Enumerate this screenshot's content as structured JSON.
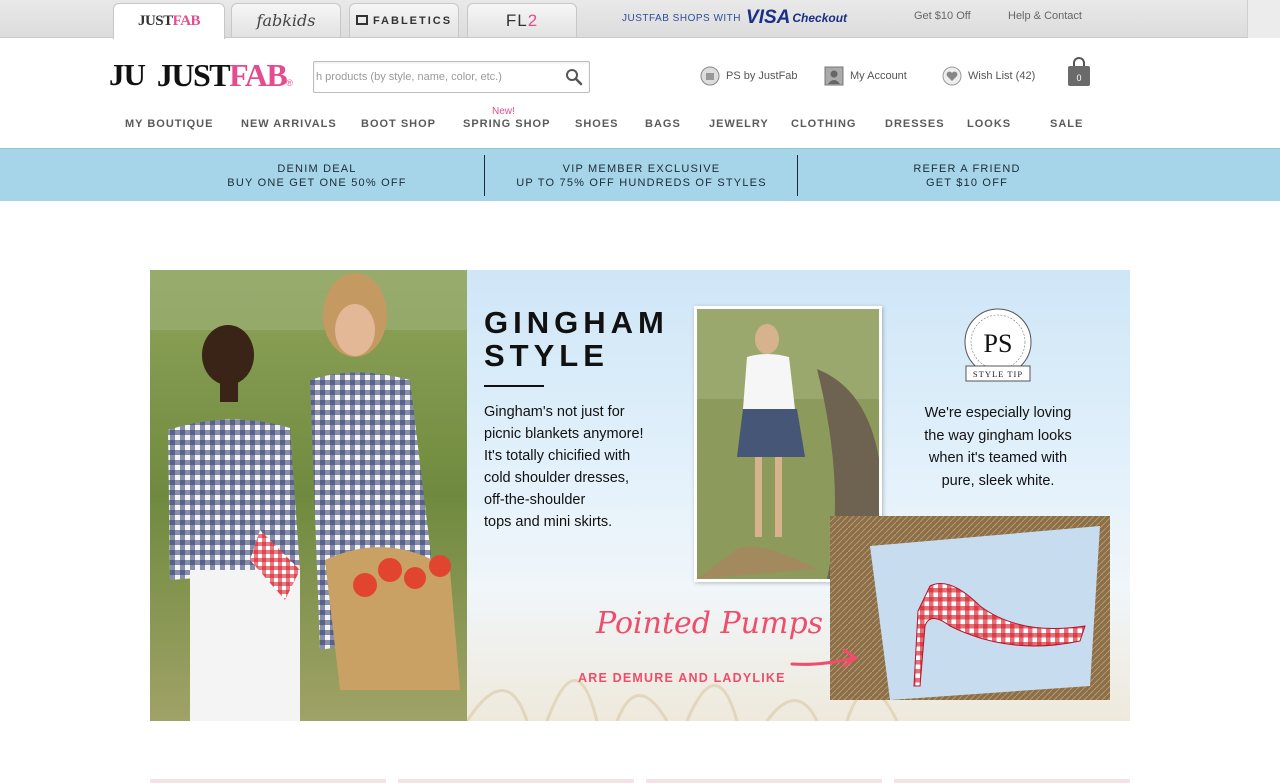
{
  "brand_tabs": [
    {
      "label": "JUST",
      "accent": "FAB"
    },
    {
      "label": "fabkids"
    },
    {
      "label": "FABLETICS"
    },
    {
      "label": "FL",
      "accent": "2"
    }
  ],
  "visa": {
    "prefix": "JUSTFAB SHOPS WITH",
    "logo": "VISA",
    "suffix": "Checkout"
  },
  "utility": {
    "get10": "Get $10 Off",
    "help": "Help & Contact"
  },
  "logo": {
    "mono": "JU",
    "name": "JUST",
    "accent": "FAB",
    "reg": "®"
  },
  "search": {
    "placeholder": "h products (by style, name, color, etc.)"
  },
  "header_links": {
    "ps": "PS by JustFab",
    "account": "My Account",
    "wishlist": "Wish List (42)",
    "bag_count": "0"
  },
  "nav": {
    "new_tag": "New!",
    "items": [
      "MY BOUTIQUE",
      "NEW ARRIVALS",
      "BOOT SHOP",
      "SPRING SHOP",
      "SHOES",
      "BAGS",
      "JEWELRY",
      "CLOTHING",
      "DRESSES",
      "LOOKS",
      "SALE"
    ]
  },
  "promos": [
    {
      "line1": "DENIM DEAL",
      "line2": "BUY ONE GET ONE 50% OFF"
    },
    {
      "line1": "VIP MEMBER EXCLUSIVE",
      "line2": "UP TO 75% OFF HUNDREDS OF STYLES"
    },
    {
      "line1": "REFER A FRIEND",
      "line2": "GET $10 OFF"
    }
  ],
  "hero": {
    "title_line1": "GINGHAM",
    "title_line2": "STYLE",
    "body": [
      "Gingham's not just for",
      "picnic blankets anymore!",
      "It's totally chicified with",
      "cold shoulder dresses,",
      "off-the-shoulder",
      "tops and mini skirts."
    ],
    "badge_mono": "PS",
    "badge_ring": "PERSONAL STYLIST",
    "badge_label": "STYLE TIP",
    "tip": [
      "We're especially loving",
      "the way gingham looks",
      "when it's teamed with",
      "pure, sleek white."
    ],
    "script": "Pointed Pumps",
    "sub": "ARE DEMURE AND LADYLIKE"
  },
  "colors": {
    "brand_pink": "#e44c8f",
    "promo_bg": "#a6d4e8",
    "coral": "#ef4d6b",
    "visa_blue": "#1a2f86"
  }
}
